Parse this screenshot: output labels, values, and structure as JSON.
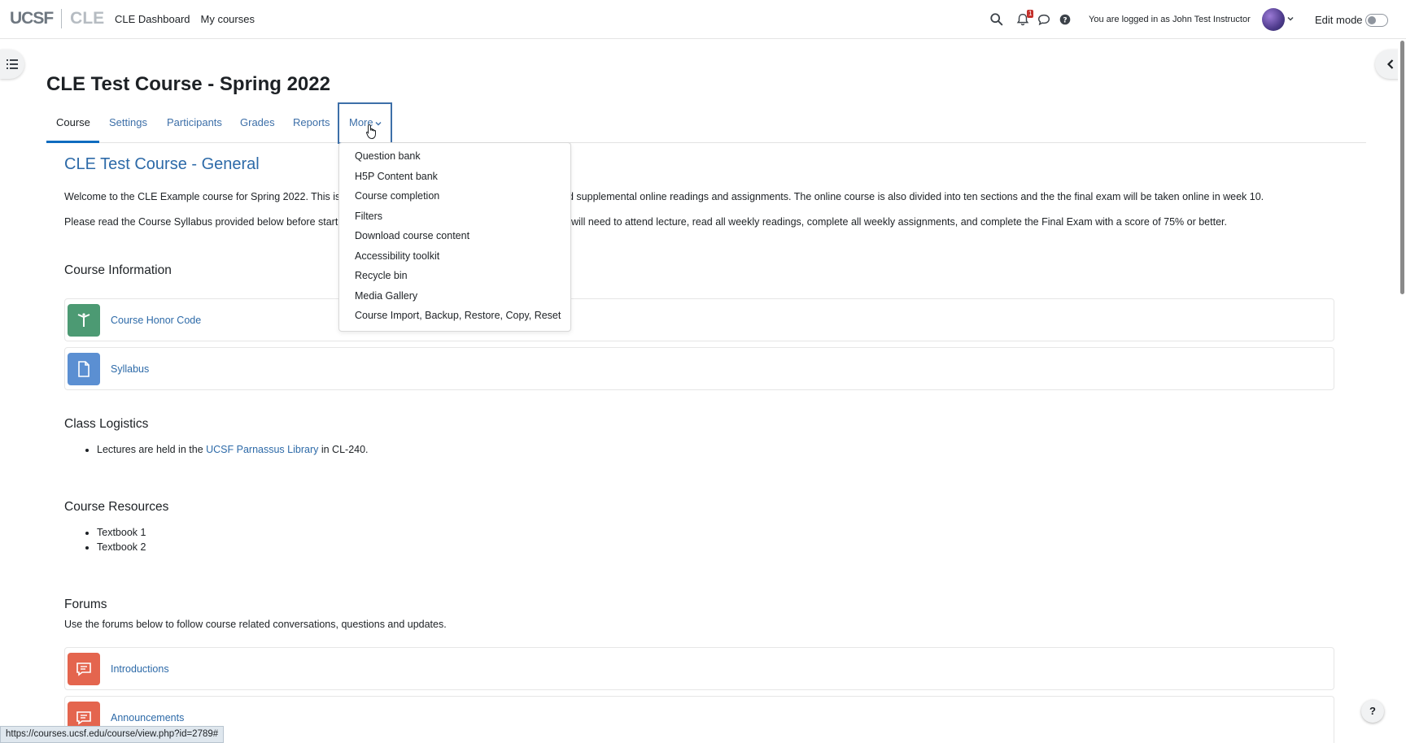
{
  "brand": {
    "logo_left": "UCSF",
    "logo_right": "CLE"
  },
  "topnav": {
    "items": [
      "CLE Dashboard",
      "My courses"
    ]
  },
  "user": {
    "notification_count": "1",
    "login_text": "You are logged in as John Test Instructor",
    "edit_mode_label": "Edit mode"
  },
  "course": {
    "title": "CLE Test Course - Spring 2022"
  },
  "tabs": {
    "items": [
      "Course",
      "Settings",
      "Participants",
      "Grades",
      "Reports",
      "More"
    ],
    "active": "Course"
  },
  "dropdown": {
    "items": [
      "Question bank",
      "H5P Content bank",
      "Course completion",
      "Filters",
      "Download course content",
      "Accessibility toolkit",
      "Recycle bin",
      "Media Gallery",
      "Course Import, Backup, Restore, Copy, Reset"
    ]
  },
  "content": {
    "section_title": "CLE Test Course - General",
    "welcome_left": "Welcome to the CLE Example course for Spring 2022. This is a",
    "welcome_right": "d supplemental online readings and assignments. The online course is also divided into ten sections and the the final exam will be taken online in week 10.",
    "syllabus_left": "Please read the Course Syllabus provided below before startin",
    "syllabus_right": "will need to attend lecture, read all weekly readings, complete all weekly assignments, and complete the Final Exam with a score of 75% or better.",
    "course_info_heading": "Course Information",
    "honor_code": "Course Honor Code",
    "syllabus": "Syllabus",
    "logistics_heading": "Class Logistics",
    "logistics_before": "Lectures are held in the",
    "logistics_link": "UCSF Parnassus Library",
    "logistics_after": "in CL-240.",
    "resources_heading": "Course Resources",
    "resources": [
      "Textbook 1",
      "Textbook 2"
    ],
    "forums_heading": "Forums",
    "forums_desc": "Use the forums below to follow course related conversations, questions and updates.",
    "forum_intro": "Introductions",
    "forum_announce": "Announcements"
  },
  "colors": {
    "accent": "#0f6cbf",
    "link": "#2d6aa8",
    "honor_icon": "#4c9a73",
    "file_icon": "#5b8fd2",
    "forum_icon": "#e4654e"
  },
  "statusbar": {
    "url": "https://courses.ucsf.edu/course/view.php?id=2789#"
  },
  "help": {
    "label": "?"
  }
}
